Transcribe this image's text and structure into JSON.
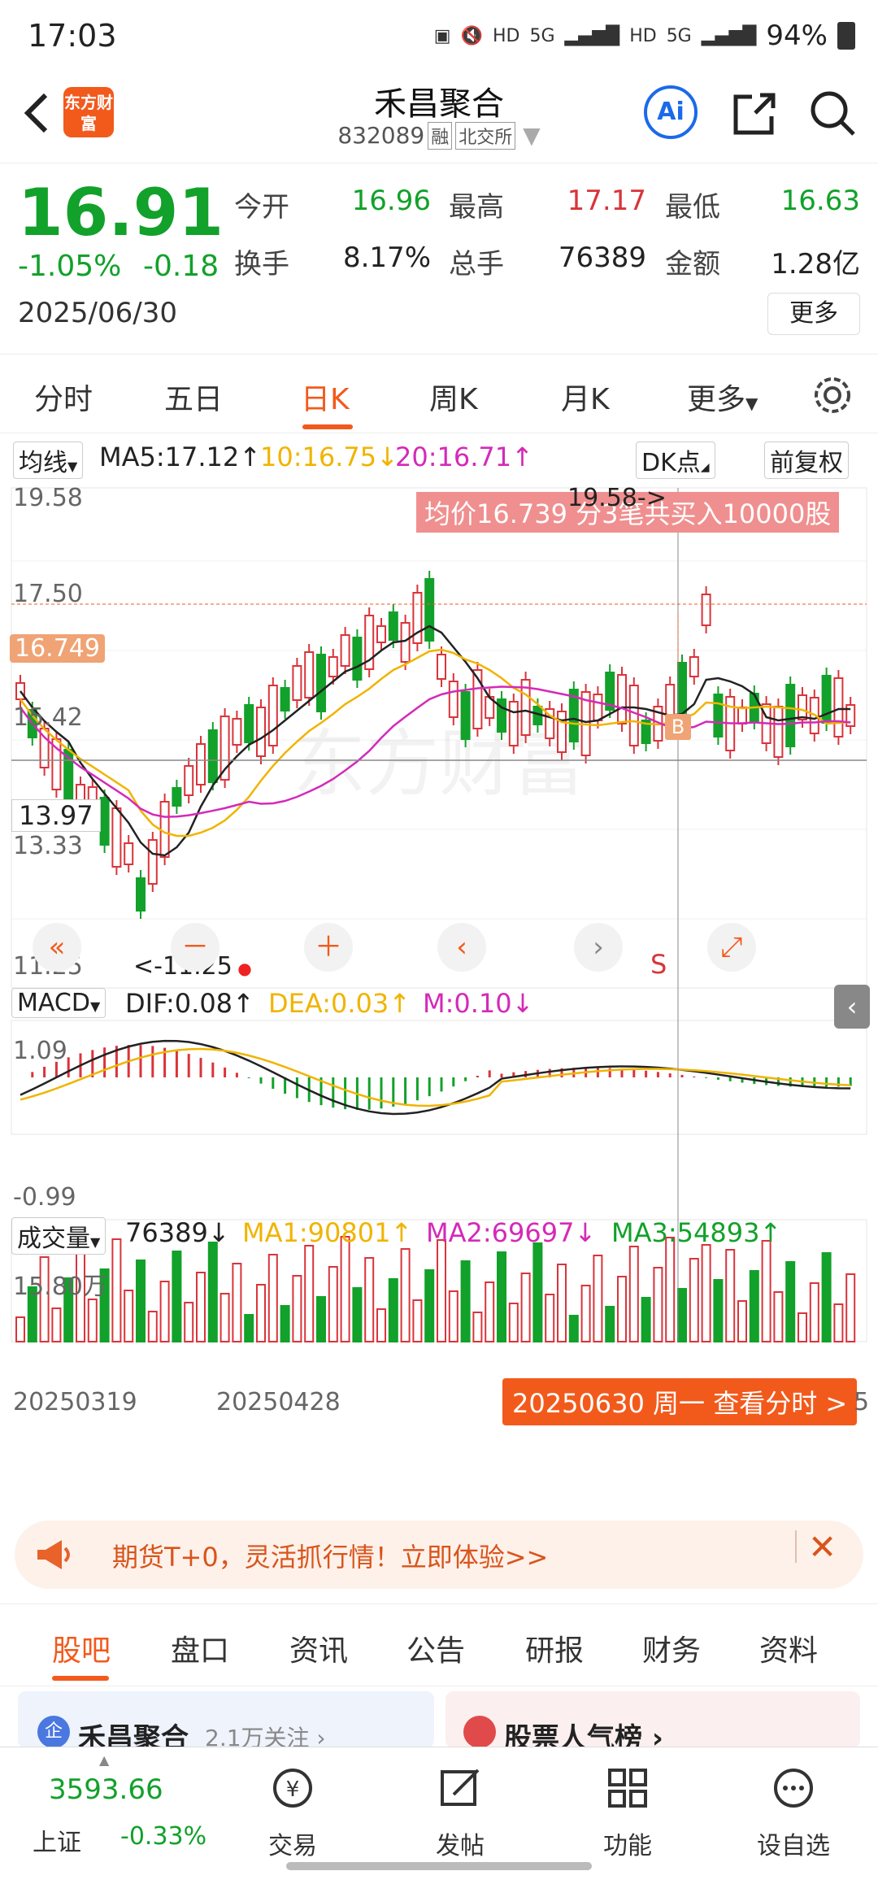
{
  "status_bar": {
    "time": "17:03",
    "battery": "94%",
    "signal_labels": [
      "HD",
      "5G",
      "HD",
      "5G"
    ]
  },
  "header": {
    "logo_text": "东方财富",
    "title": "禾昌聚合",
    "code": "832089",
    "tag_margin": "融",
    "tag_exchange": "北交所",
    "ai_label": "Ai"
  },
  "quote": {
    "price": "16.91",
    "change_pct": "-1.05%",
    "change": "-0.18",
    "date": "2025/06/30",
    "open_label": "今开",
    "open": "16.96",
    "high_label": "最高",
    "high": "17.17",
    "low_label": "最低",
    "low": "16.63",
    "turnover_label": "换手",
    "turnover": "8.17%",
    "volume_label": "总手",
    "volume": "76389",
    "amount_label": "金额",
    "amount": "1.28亿",
    "more": "更多"
  },
  "ktabs": [
    "分时",
    "五日",
    "日K",
    "周K",
    "月K",
    "更多"
  ],
  "active_ktab": "日K",
  "chart_top": {
    "ma_selector": "均线",
    "ma5": "MA5:17.12↑",
    "ma10": "10:16.75↓",
    "ma20": "20:16.71↑",
    "dk_label": "DK点",
    "fq_label": "前复权",
    "avg_banner": "均价16.739  分3笔共买入10000股",
    "y_labels": [
      "19.58",
      "17.50",
      "15.42",
      "13.33",
      "11.25"
    ],
    "crosshair_price": "16.749",
    "cursor_price": "13.97",
    "high_marker": "19.58->",
    "low_marker": "<-11.25",
    "buy_marker": "B",
    "sell_marker": "S",
    "watermark": "东方财富"
  },
  "macd": {
    "selector": "MACD",
    "dif": "DIF:0.08↑",
    "dea": "DEA:0.03↑",
    "m": "M:0.10↓",
    "y_top": "1.09",
    "y_bottom": "-0.99"
  },
  "volume": {
    "selector": "成交量",
    "value": "76389↓",
    "ma1": "MA1:90801↑",
    "ma2": "MA2:69697↓",
    "ma3": "MA3:54893↑",
    "y_top": "15.80万"
  },
  "x_labels": [
    "20250319",
    "20250428"
  ],
  "cursor_tip": "20250630 周一 查看分时 >",
  "cursor_tip_tail": "5",
  "colors": {
    "up": "#d9343a",
    "down": "#12a12a",
    "accent": "#f25a1c",
    "ma5": "#222222",
    "ma10": "#f0b400",
    "ma20": "#d42ab8"
  },
  "banner": {
    "text": "期货T+0，灵活抓行情！立即体验>>"
  },
  "btabs": [
    "股吧",
    "盘口",
    "资讯",
    "公告",
    "研报",
    "财务",
    "资料"
  ],
  "cards": {
    "left_title": "禾昌聚合",
    "left_sub": "2.1万关注 ›",
    "left_badge": "企",
    "right_title": "股票人气榜 ›"
  },
  "nav": {
    "index_value": "3593.66",
    "index_name": "上证",
    "index_change": "-0.33%",
    "items": [
      "交易",
      "发帖",
      "功能",
      "设自选"
    ]
  }
}
